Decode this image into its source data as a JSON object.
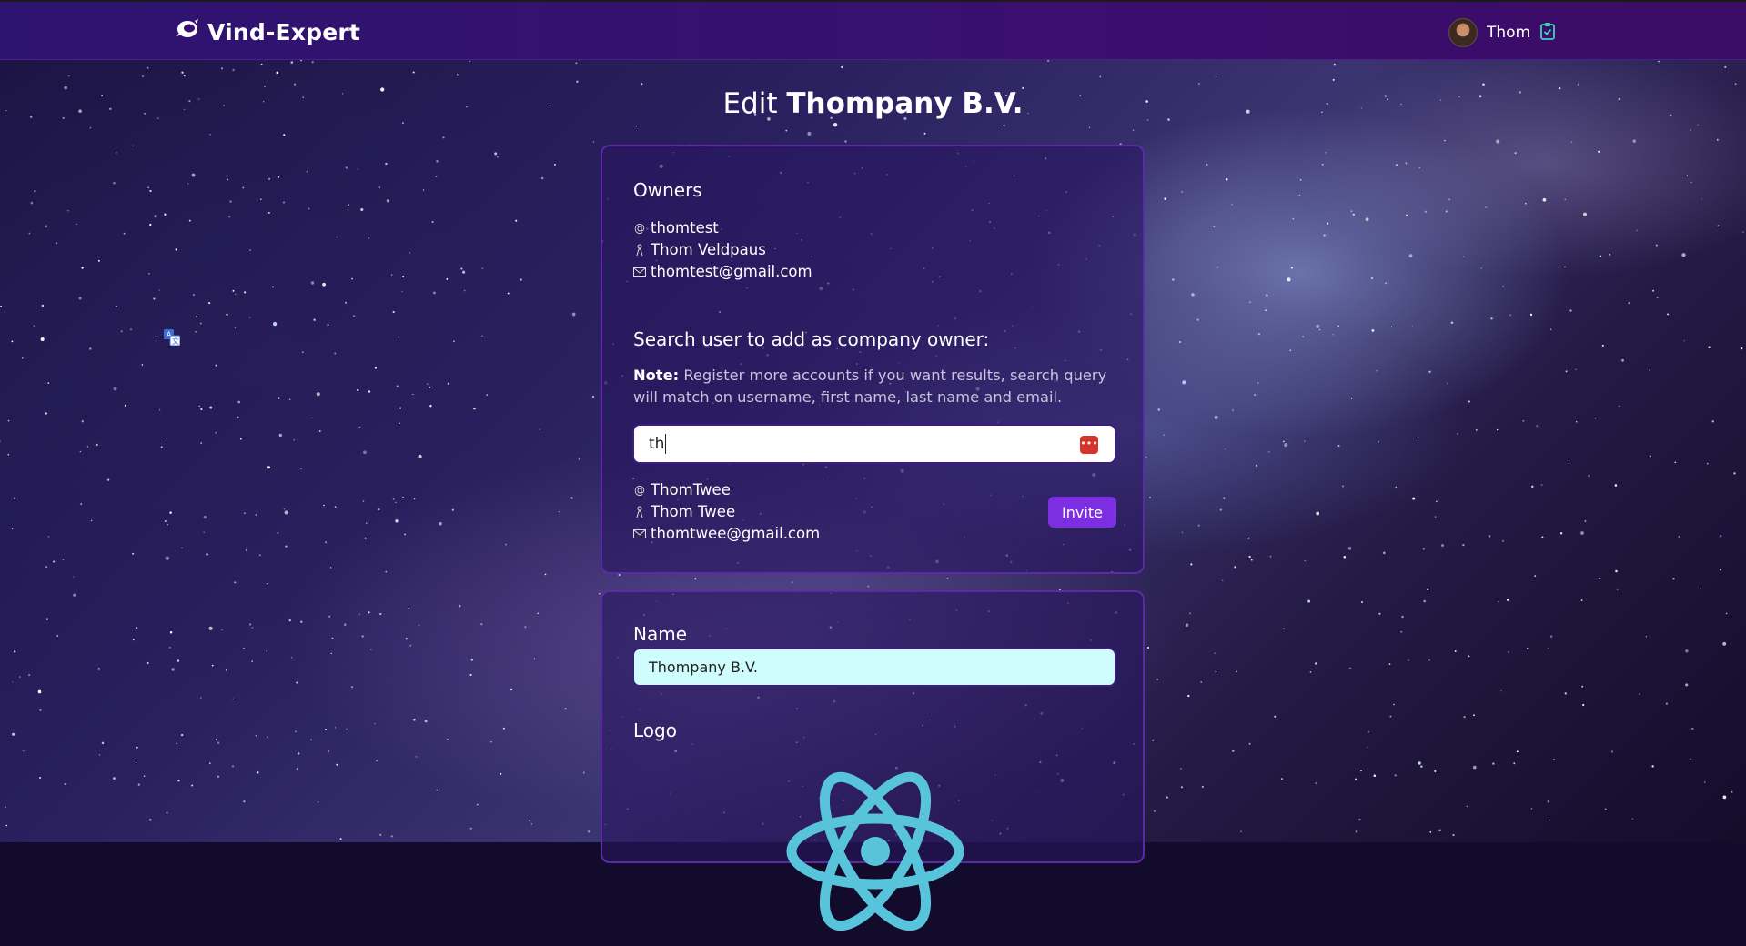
{
  "nav": {
    "brand": "Vind-Expert",
    "user_name": "Thom"
  },
  "page": {
    "title_prefix": "Edit",
    "title_company": "Thompany B.V."
  },
  "owners": {
    "heading": "Owners",
    "username": "thomtest",
    "full_name": "Thom Veldpaus",
    "email": "thomtest@gmail.com"
  },
  "search": {
    "heading": "Search user to add as company owner:",
    "note_label": "Note:",
    "note_text": " Register more accounts if you want results, search query will match on username, first name, last name and email.",
    "query": "th"
  },
  "result": {
    "username": "ThomTwee",
    "full_name": "Thom Twee",
    "email": "thomtwee@gmail.com",
    "invite_label": "Invite"
  },
  "company_form": {
    "name_label": "Name",
    "name_value": "Thompany B.V.",
    "logo_label": "Logo"
  },
  "colors": {
    "nav_bg": "#3a0f6e",
    "accent": "#7c2fe0",
    "react_blue": "#58c4dc"
  },
  "icons": {
    "brand": "astronaut-icon",
    "clipboard": "clipboard-check-icon",
    "username": "at-icon",
    "name": "person-icon",
    "email": "mail-icon",
    "password_manager": "password-manager-icon",
    "translate": "translate-icon",
    "logo": "react-logo-icon"
  }
}
